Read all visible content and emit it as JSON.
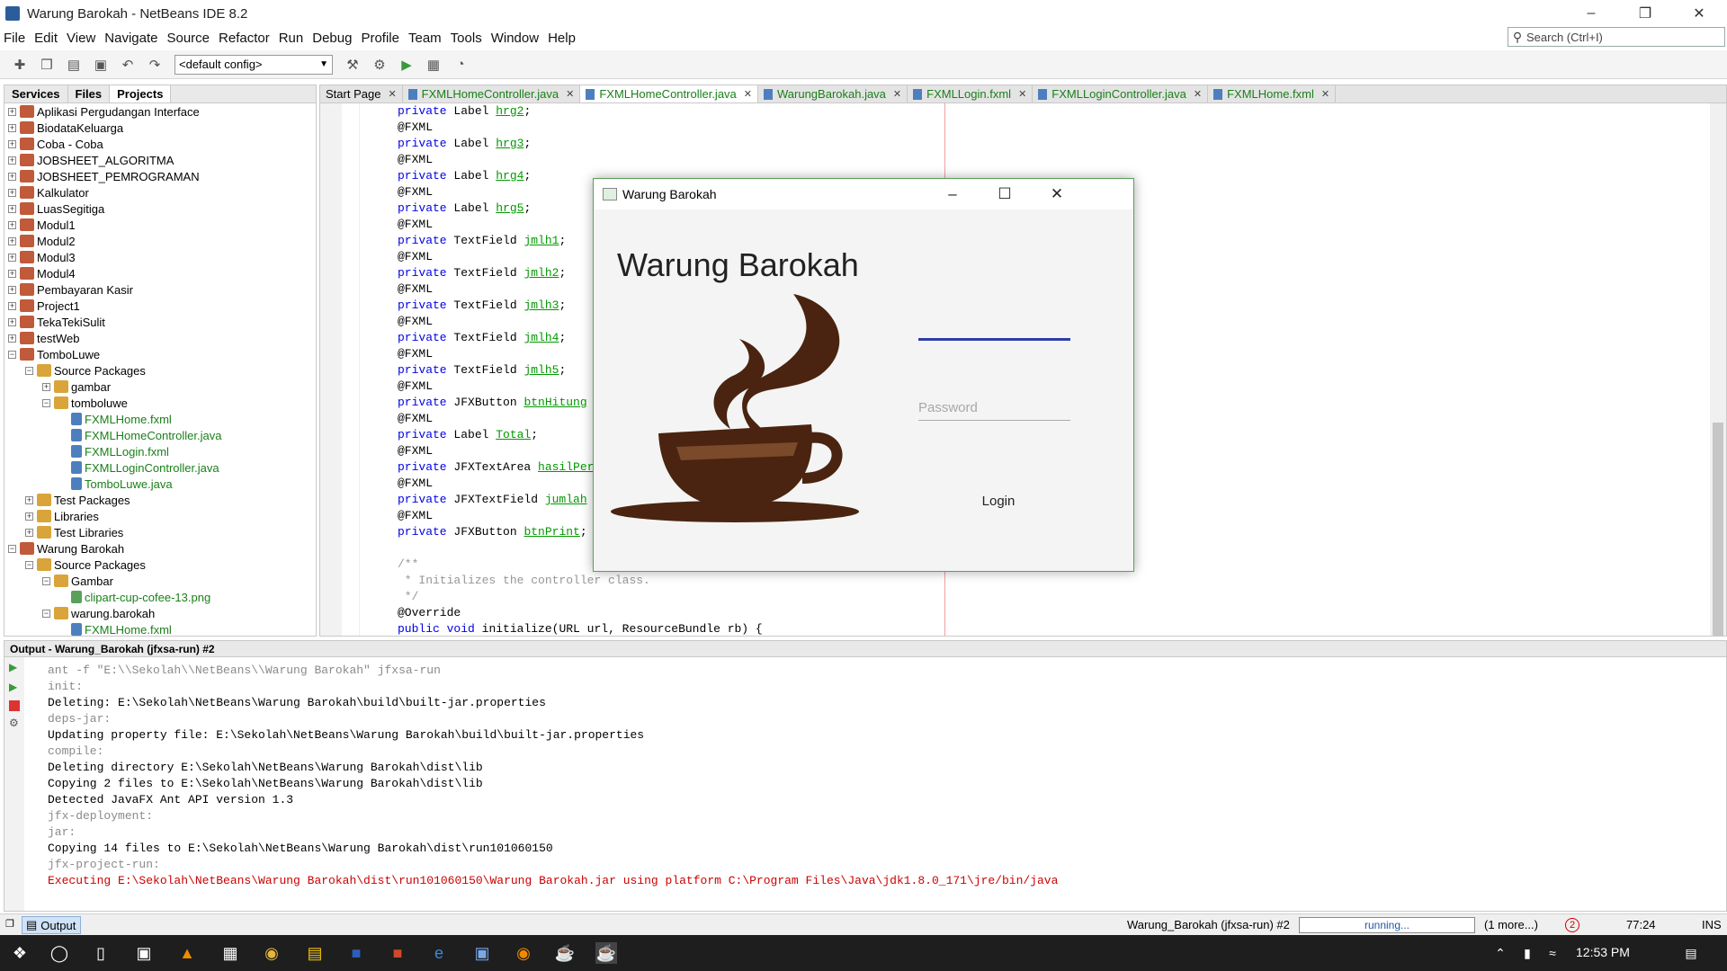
{
  "window": {
    "title": "Warung Barokah - NetBeans IDE 8.2"
  },
  "menu": [
    "File",
    "Edit",
    "View",
    "Navigate",
    "Source",
    "Refactor",
    "Run",
    "Debug",
    "Profile",
    "Team",
    "Tools",
    "Window",
    "Help"
  ],
  "search": {
    "placeholder": "Search (Ctrl+I)"
  },
  "toolbar": {
    "config": "<default config>"
  },
  "left_panel": {
    "tabs": [
      "Services",
      "Files",
      "Projects"
    ],
    "tree": [
      {
        "label": "Aplikasi Pergudangan Interface",
        "level": 0,
        "kind": "proj"
      },
      {
        "label": "BiodataKeluarga",
        "level": 0,
        "kind": "proj"
      },
      {
        "label": "Coba - Coba",
        "level": 0,
        "kind": "proj"
      },
      {
        "label": "JOBSHEET_ALGORITMA",
        "level": 0,
        "kind": "proj"
      },
      {
        "label": "JOBSHEET_PEMROGRAMAN",
        "level": 0,
        "kind": "proj"
      },
      {
        "label": "Kalkulator",
        "level": 0,
        "kind": "proj"
      },
      {
        "label": "LuasSegitiga",
        "level": 0,
        "kind": "proj"
      },
      {
        "label": "Modul1",
        "level": 0,
        "kind": "proj"
      },
      {
        "label": "Modul2",
        "level": 0,
        "kind": "proj"
      },
      {
        "label": "Modul3",
        "level": 0,
        "kind": "proj"
      },
      {
        "label": "Modul4",
        "level": 0,
        "kind": "proj"
      },
      {
        "label": "Pembayaran Kasir",
        "level": 0,
        "kind": "proj"
      },
      {
        "label": "Project1",
        "level": 0,
        "kind": "proj"
      },
      {
        "label": "TekaTekiSulit",
        "level": 0,
        "kind": "proj"
      },
      {
        "label": "testWeb",
        "level": 0,
        "kind": "proj"
      },
      {
        "label": "TomboLuwe",
        "level": 0,
        "kind": "proj",
        "open": true
      },
      {
        "label": "Source Packages",
        "level": 1,
        "kind": "pkg",
        "open": true
      },
      {
        "label": "gambar",
        "level": 2,
        "kind": "pkg"
      },
      {
        "label": "tomboluwe",
        "level": 2,
        "kind": "pkg",
        "open": true
      },
      {
        "label": "FXMLHome.fxml",
        "level": 3,
        "kind": "file",
        "green": true
      },
      {
        "label": "FXMLHomeController.java",
        "level": 3,
        "kind": "file",
        "green": true
      },
      {
        "label": "FXMLLogin.fxml",
        "level": 3,
        "kind": "file",
        "green": true
      },
      {
        "label": "FXMLLoginController.java",
        "level": 3,
        "kind": "file",
        "green": true
      },
      {
        "label": "TomboLuwe.java",
        "level": 3,
        "kind": "file",
        "green": true
      },
      {
        "label": "Test Packages",
        "level": 1,
        "kind": "pkg"
      },
      {
        "label": "Libraries",
        "level": 1,
        "kind": "pkg"
      },
      {
        "label": "Test Libraries",
        "level": 1,
        "kind": "pkg"
      },
      {
        "label": "Warung Barokah",
        "level": 0,
        "kind": "proj",
        "open": true
      },
      {
        "label": "Source Packages",
        "level": 1,
        "kind": "pkg",
        "open": true
      },
      {
        "label": "Gambar",
        "level": 2,
        "kind": "pkg",
        "open": true
      },
      {
        "label": "clipart-cup-cofee-13.png",
        "level": 3,
        "kind": "img",
        "green": true
      },
      {
        "label": "warung.barokah",
        "level": 2,
        "kind": "pkg",
        "open": true
      },
      {
        "label": "FXMLHome.fxml",
        "level": 3,
        "kind": "file",
        "green": true
      }
    ]
  },
  "editor": {
    "tabs": [
      {
        "label": "Start Page",
        "plain": true
      },
      {
        "label": "FXMLHomeController.java"
      },
      {
        "label": "FXMLHomeController.java",
        "active": true
      },
      {
        "label": "WarungBarokah.java"
      },
      {
        "label": "FXMLLogin.fxml"
      },
      {
        "label": "FXMLLoginController.java"
      },
      {
        "label": "FXMLHome.fxml"
      }
    ],
    "code": [
      [
        {
          "t": "private",
          "c": "kw"
        },
        {
          "t": " Label "
        },
        {
          "t": "hrg2",
          "c": "fld"
        },
        {
          "t": ";"
        }
      ],
      [
        {
          "t": "@FXML"
        }
      ],
      [
        {
          "t": "private",
          "c": "kw"
        },
        {
          "t": " Label "
        },
        {
          "t": "hrg3",
          "c": "fld"
        },
        {
          "t": ";"
        }
      ],
      [
        {
          "t": "@FXML"
        }
      ],
      [
        {
          "t": "private",
          "c": "kw"
        },
        {
          "t": " Label "
        },
        {
          "t": "hrg4",
          "c": "fld"
        },
        {
          "t": ";"
        }
      ],
      [
        {
          "t": "@FXML"
        }
      ],
      [
        {
          "t": "private",
          "c": "kw"
        },
        {
          "t": " Label "
        },
        {
          "t": "hrg5",
          "c": "fld"
        },
        {
          "t": ";"
        }
      ],
      [
        {
          "t": "@FXML"
        }
      ],
      [
        {
          "t": "private",
          "c": "kw"
        },
        {
          "t": " TextField "
        },
        {
          "t": "jmlh1",
          "c": "fld"
        },
        {
          "t": ";"
        }
      ],
      [
        {
          "t": "@FXML"
        }
      ],
      [
        {
          "t": "private",
          "c": "kw"
        },
        {
          "t": " TextField "
        },
        {
          "t": "jmlh2",
          "c": "fld"
        },
        {
          "t": ";"
        }
      ],
      [
        {
          "t": "@FXML"
        }
      ],
      [
        {
          "t": "private",
          "c": "kw"
        },
        {
          "t": " TextField "
        },
        {
          "t": "jmlh3",
          "c": "fld"
        },
        {
          "t": ";"
        }
      ],
      [
        {
          "t": "@FXML"
        }
      ],
      [
        {
          "t": "private",
          "c": "kw"
        },
        {
          "t": " TextField "
        },
        {
          "t": "jmlh4",
          "c": "fld"
        },
        {
          "t": ";"
        }
      ],
      [
        {
          "t": "@FXML"
        }
      ],
      [
        {
          "t": "private",
          "c": "kw"
        },
        {
          "t": " TextField "
        },
        {
          "t": "jmlh5",
          "c": "fld"
        },
        {
          "t": ";"
        }
      ],
      [
        {
          "t": "@FXML"
        }
      ],
      [
        {
          "t": "private",
          "c": "kw"
        },
        {
          "t": " JFXButton "
        },
        {
          "t": "btnHitung",
          "c": "fld"
        }
      ],
      [
        {
          "t": "@FXML"
        }
      ],
      [
        {
          "t": "private",
          "c": "kw"
        },
        {
          "t": " Label "
        },
        {
          "t": "Total",
          "c": "fld"
        },
        {
          "t": ";"
        }
      ],
      [
        {
          "t": "@FXML"
        }
      ],
      [
        {
          "t": "private",
          "c": "kw"
        },
        {
          "t": " JFXTextArea "
        },
        {
          "t": "hasilPer",
          "c": "fld"
        }
      ],
      [
        {
          "t": "@FXML"
        }
      ],
      [
        {
          "t": "private",
          "c": "kw"
        },
        {
          "t": " JFXTextField "
        },
        {
          "t": "jumlah",
          "c": "fld"
        }
      ],
      [
        {
          "t": "@FXML"
        }
      ],
      [
        {
          "t": "private",
          "c": "kw"
        },
        {
          "t": " JFXButton "
        },
        {
          "t": "btnPrint",
          "c": "fld"
        },
        {
          "t": ";"
        }
      ],
      [
        {
          "t": ""
        }
      ],
      [
        {
          "t": "/**",
          "c": "cm"
        }
      ],
      [
        {
          "t": " * Initializes the controller class.",
          "c": "cm"
        }
      ],
      [
        {
          "t": " */",
          "c": "cm"
        }
      ],
      [
        {
          "t": "@Override"
        }
      ],
      [
        {
          "t": "public",
          "c": "kw"
        },
        {
          "t": " "
        },
        {
          "t": "void",
          "c": "kw"
        },
        {
          "t": " initialize(URL url, ResourceBundle rb) {"
        }
      ]
    ]
  },
  "dialog": {
    "title": "Warung Barokah",
    "heading": "Warung Barokah",
    "password_placeholder": "Password",
    "login_label": "Login"
  },
  "output": {
    "header": "Output - Warung_Barokah (jfxsa-run) #2",
    "lines": [
      {
        "t": "ant -f \"E:\\\\Sekolah\\\\NetBeans\\\\Warung Barokah\" jfxsa-run",
        "c": "grey"
      },
      {
        "t": "init:",
        "c": "grey"
      },
      {
        "t": "Deleting: E:\\Sekolah\\NetBeans\\Warung Barokah\\build\\built-jar.properties"
      },
      {
        "t": "deps-jar:",
        "c": "grey"
      },
      {
        "t": "Updating property file: E:\\Sekolah\\NetBeans\\Warung Barokah\\build\\built-jar.properties"
      },
      {
        "t": "compile:",
        "c": "grey"
      },
      {
        "t": "Deleting directory E:\\Sekolah\\NetBeans\\Warung Barokah\\dist\\lib"
      },
      {
        "t": "Copying 2 files to E:\\Sekolah\\NetBeans\\Warung Barokah\\dist\\lib"
      },
      {
        "t": "Detected JavaFX Ant API version 1.3"
      },
      {
        "t": "jfx-deployment:",
        "c": "grey"
      },
      {
        "t": "jar:",
        "c": "grey"
      },
      {
        "t": "Copying 14 files to E:\\Sekolah\\NetBeans\\Warung Barokah\\dist\\run101060150"
      },
      {
        "t": "jfx-project-run:",
        "c": "grey"
      },
      {
        "t": "Executing E:\\Sekolah\\NetBeans\\Warung Barokah\\dist\\run101060150\\Warung Barokah.jar using platform C:\\Program Files\\Java\\jdk1.8.0_171\\jre/bin/java",
        "c": "red"
      }
    ]
  },
  "status": {
    "output_tab": "Output",
    "task": "Warung_Barokah (jfxsa-run) #2",
    "progress": "running...",
    "more": "(1 more...)",
    "notifications": "2",
    "position": "77:24",
    "mode": "INS"
  },
  "taskbar": {
    "time": "12:53 PM"
  }
}
